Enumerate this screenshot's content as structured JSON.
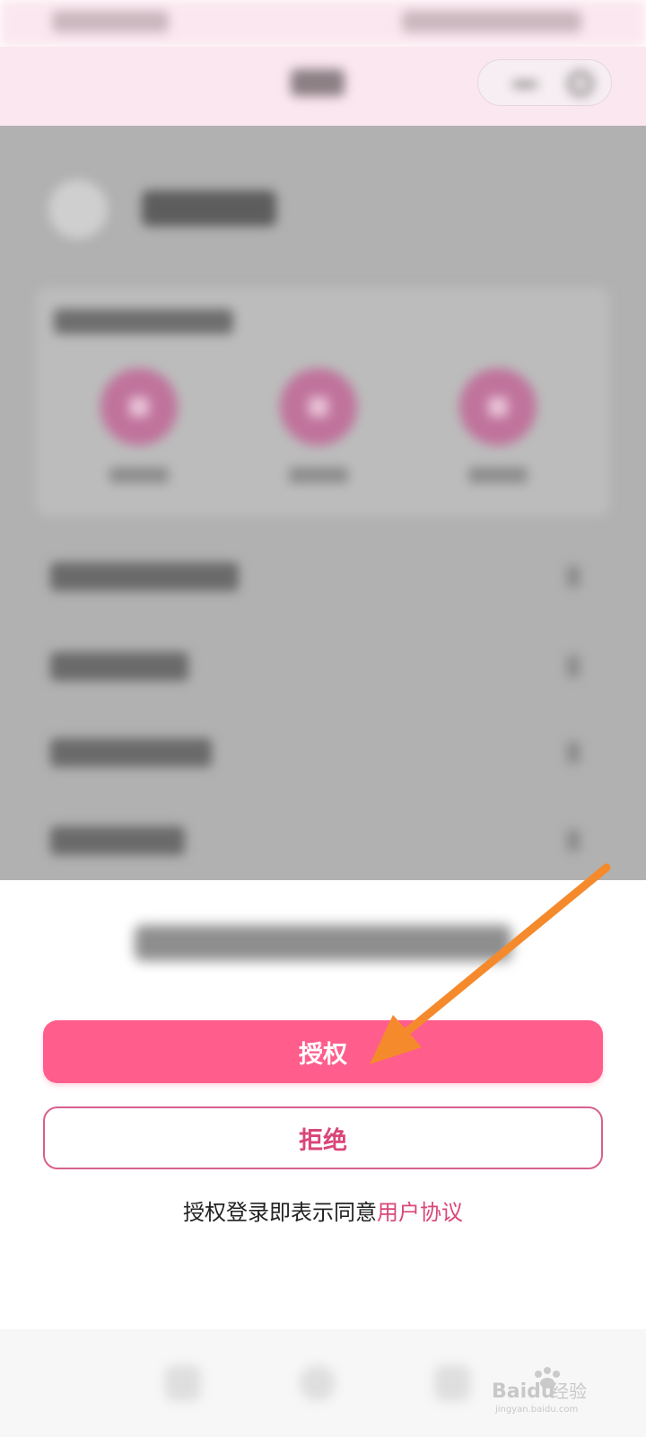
{
  "sheet": {
    "authorize_label": "授权",
    "refuse_label": "拒绝",
    "agreement_prefix": "授权登录即表示同意",
    "agreement_link": "用户协议"
  },
  "watermark": {
    "text": "Baidu经验",
    "subtext": "jingyan.baidu.com"
  },
  "colors": {
    "accent": "#ff5d8c",
    "link": "#d94679",
    "overlay": "#b1b1b1",
    "header_bg": "#fbe7ef",
    "annotation_arrow": "#f58a2c"
  },
  "icons": {
    "capsule": [
      "more-dots-icon",
      "close-circle-icon"
    ],
    "system_nav": [
      "back-icon",
      "home-icon",
      "recents-icon"
    ]
  }
}
